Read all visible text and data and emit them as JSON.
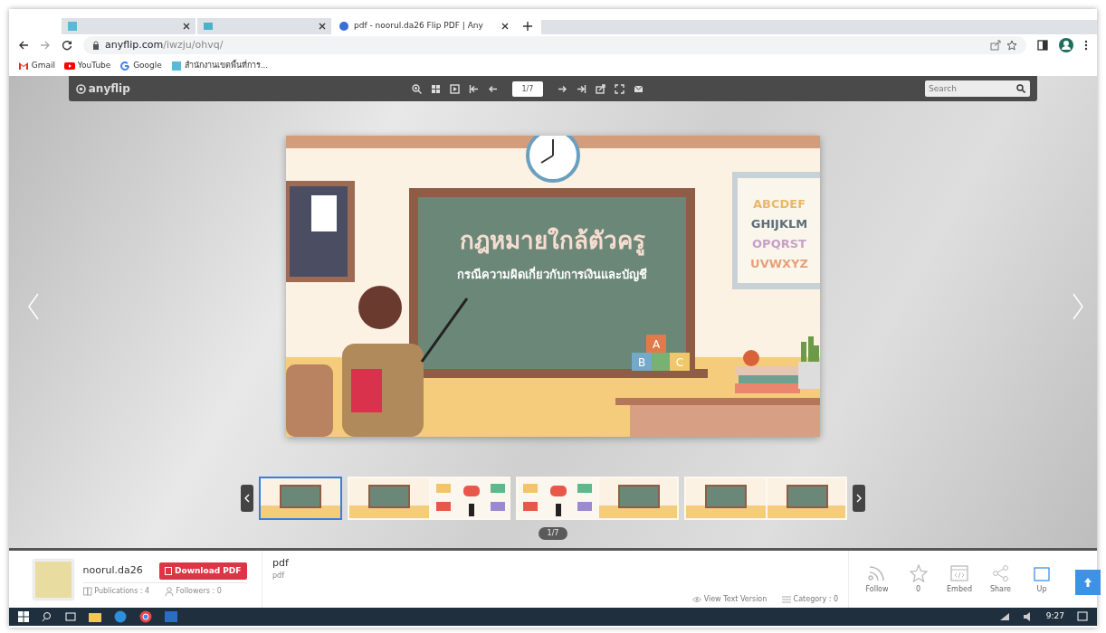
{
  "browser": {
    "tabs": [
      {
        "selected": false,
        "kind": "site"
      },
      {
        "selected": false,
        "kind": "doc"
      },
      {
        "title": "pdf - noorul.da26 Flip PDF | Any",
        "selected": true,
        "kind": "flip"
      }
    ],
    "url": {
      "host": "anyflip.com",
      "path": "/iwzju/ohvq/"
    },
    "bookmarks": [
      {
        "label": "Gmail",
        "kind": "gmail"
      },
      {
        "label": "YouTube",
        "kind": "youtube"
      },
      {
        "label": "Google",
        "kind": "google"
      },
      {
        "label": "สำนักงานเขตพื้นที่การ...",
        "kind": "site"
      }
    ]
  },
  "viewer": {
    "logo": "anyflip",
    "page_field": "1/7",
    "search": {
      "placeholder": "Search"
    },
    "slide": {
      "title": "กฎหมายใกล้ตัวครู",
      "subtitle": "กรณีความผิดเกี่ยวกับการเงินและบัญชี",
      "alphabet": [
        "ABCDEF",
        "GHIJKLM",
        "OPQRST",
        "UVWXYZ"
      ],
      "blocks": [
        "A",
        "B",
        "C"
      ]
    },
    "thumbnails": [
      {
        "kind": "single",
        "selected": true
      },
      {
        "kind": "spread",
        "selected": false
      },
      {
        "kind": "spread",
        "selected": false
      },
      {
        "kind": "spread",
        "selected": false
      }
    ],
    "page_indicator": "1/7"
  },
  "info": {
    "author": "noorul.da26",
    "download": "Download PDF",
    "publications": "Publications : 4",
    "followers": "Followers : 0",
    "title": "pdf",
    "description": "pdf",
    "view_text": "View Text Version",
    "category": "Category : 0",
    "actions": [
      {
        "kind": "rss",
        "label": "Follow"
      },
      {
        "kind": "star",
        "label": "0"
      },
      {
        "kind": "embed",
        "label": "Embed"
      },
      {
        "kind": "share",
        "label": "Share"
      },
      {
        "kind": "upload",
        "label": "Up"
      }
    ]
  },
  "taskbar": {
    "time": "9:27"
  }
}
